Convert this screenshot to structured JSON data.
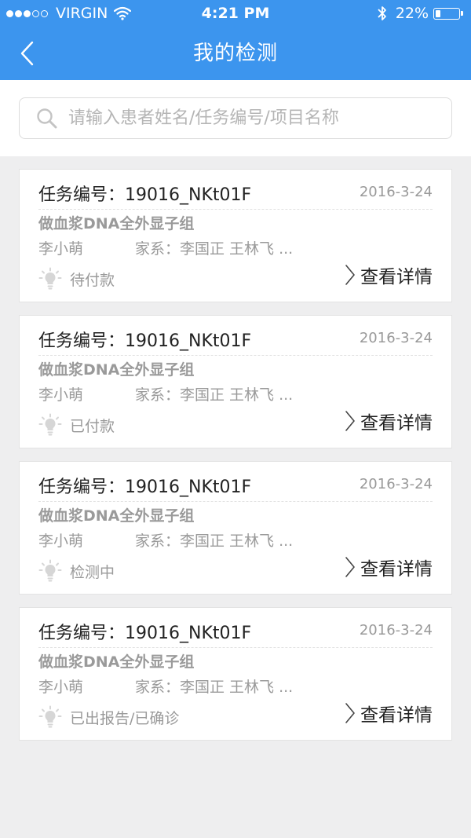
{
  "statusbar": {
    "carrier": "VIRGIN",
    "time": "4:21 PM",
    "battery_pct": "22%",
    "battery_level": 0.22
  },
  "nav": {
    "title": "我的检测"
  },
  "search": {
    "placeholder": "请输入患者姓名/任务编号/项目名称"
  },
  "cards": [
    {
      "task_no": "任务编号：19016_NKt01F",
      "date": "2016-3-24",
      "project": "做血浆DNA全外显子组",
      "patient": "李小萌",
      "family": "家系：李国正  王林飞 ...",
      "status": "待付款",
      "detail": "查看详情"
    },
    {
      "task_no": "任务编号：19016_NKt01F",
      "date": "2016-3-24",
      "project": "做血浆DNA全外显子组",
      "patient": "李小萌",
      "family": "家系：李国正  王林飞 ...",
      "status": "已付款",
      "detail": "查看详情"
    },
    {
      "task_no": "任务编号：19016_NKt01F",
      "date": "2016-3-24",
      "project": "做血浆DNA全外显子组",
      "patient": "李小萌",
      "family": "家系：李国正  王林飞 ...",
      "status": "检测中",
      "detail": "查看详情"
    },
    {
      "task_no": "任务编号：19016_NKt01F",
      "date": "2016-3-24",
      "project": "做血浆DNA全外显子组",
      "patient": "李小萌",
      "family": "家系：李国正  王林飞 ...",
      "status": "已出报告/已确诊",
      "detail": "查看详情"
    }
  ],
  "colors": {
    "header": "#3c95ee",
    "background": "#eeeeef",
    "muted_text": "#9a9a9a"
  }
}
